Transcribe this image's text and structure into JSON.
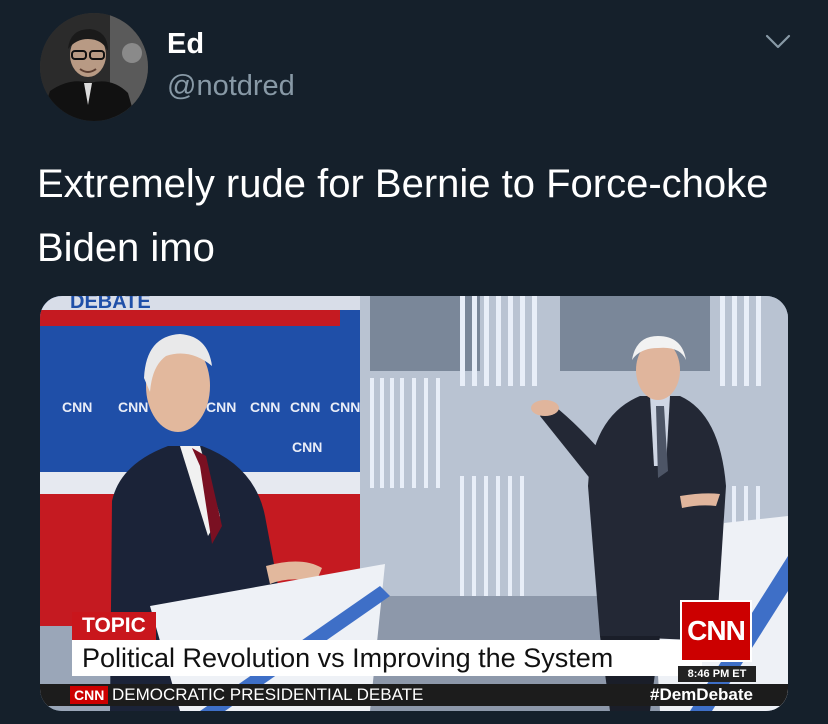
{
  "author": {
    "name": "Ed",
    "handle": "@notdred"
  },
  "tweet": {
    "text": "Extremely rude for Bernie to Force-choke Biden imo"
  },
  "media": {
    "banner_fragment": "DEBATE",
    "backdrop_logo": "CNN",
    "topic_label": "TOPIC",
    "headline": "Political Revolution vs Improving the System",
    "network_logo": "CNN",
    "time": "8:46 PM ET",
    "bottom_logo": "CNN",
    "program": "DEMOCRATIC PRESIDENTIAL DEBATE",
    "hashtag": "#DemDebate"
  },
  "colors": {
    "background": "#15202b",
    "secondary_text": "#8899a6",
    "cnn_red": "#cc0000",
    "backdrop_blue": "#1f4fa8"
  },
  "icons": {
    "menu": "chevron-down-icon"
  }
}
